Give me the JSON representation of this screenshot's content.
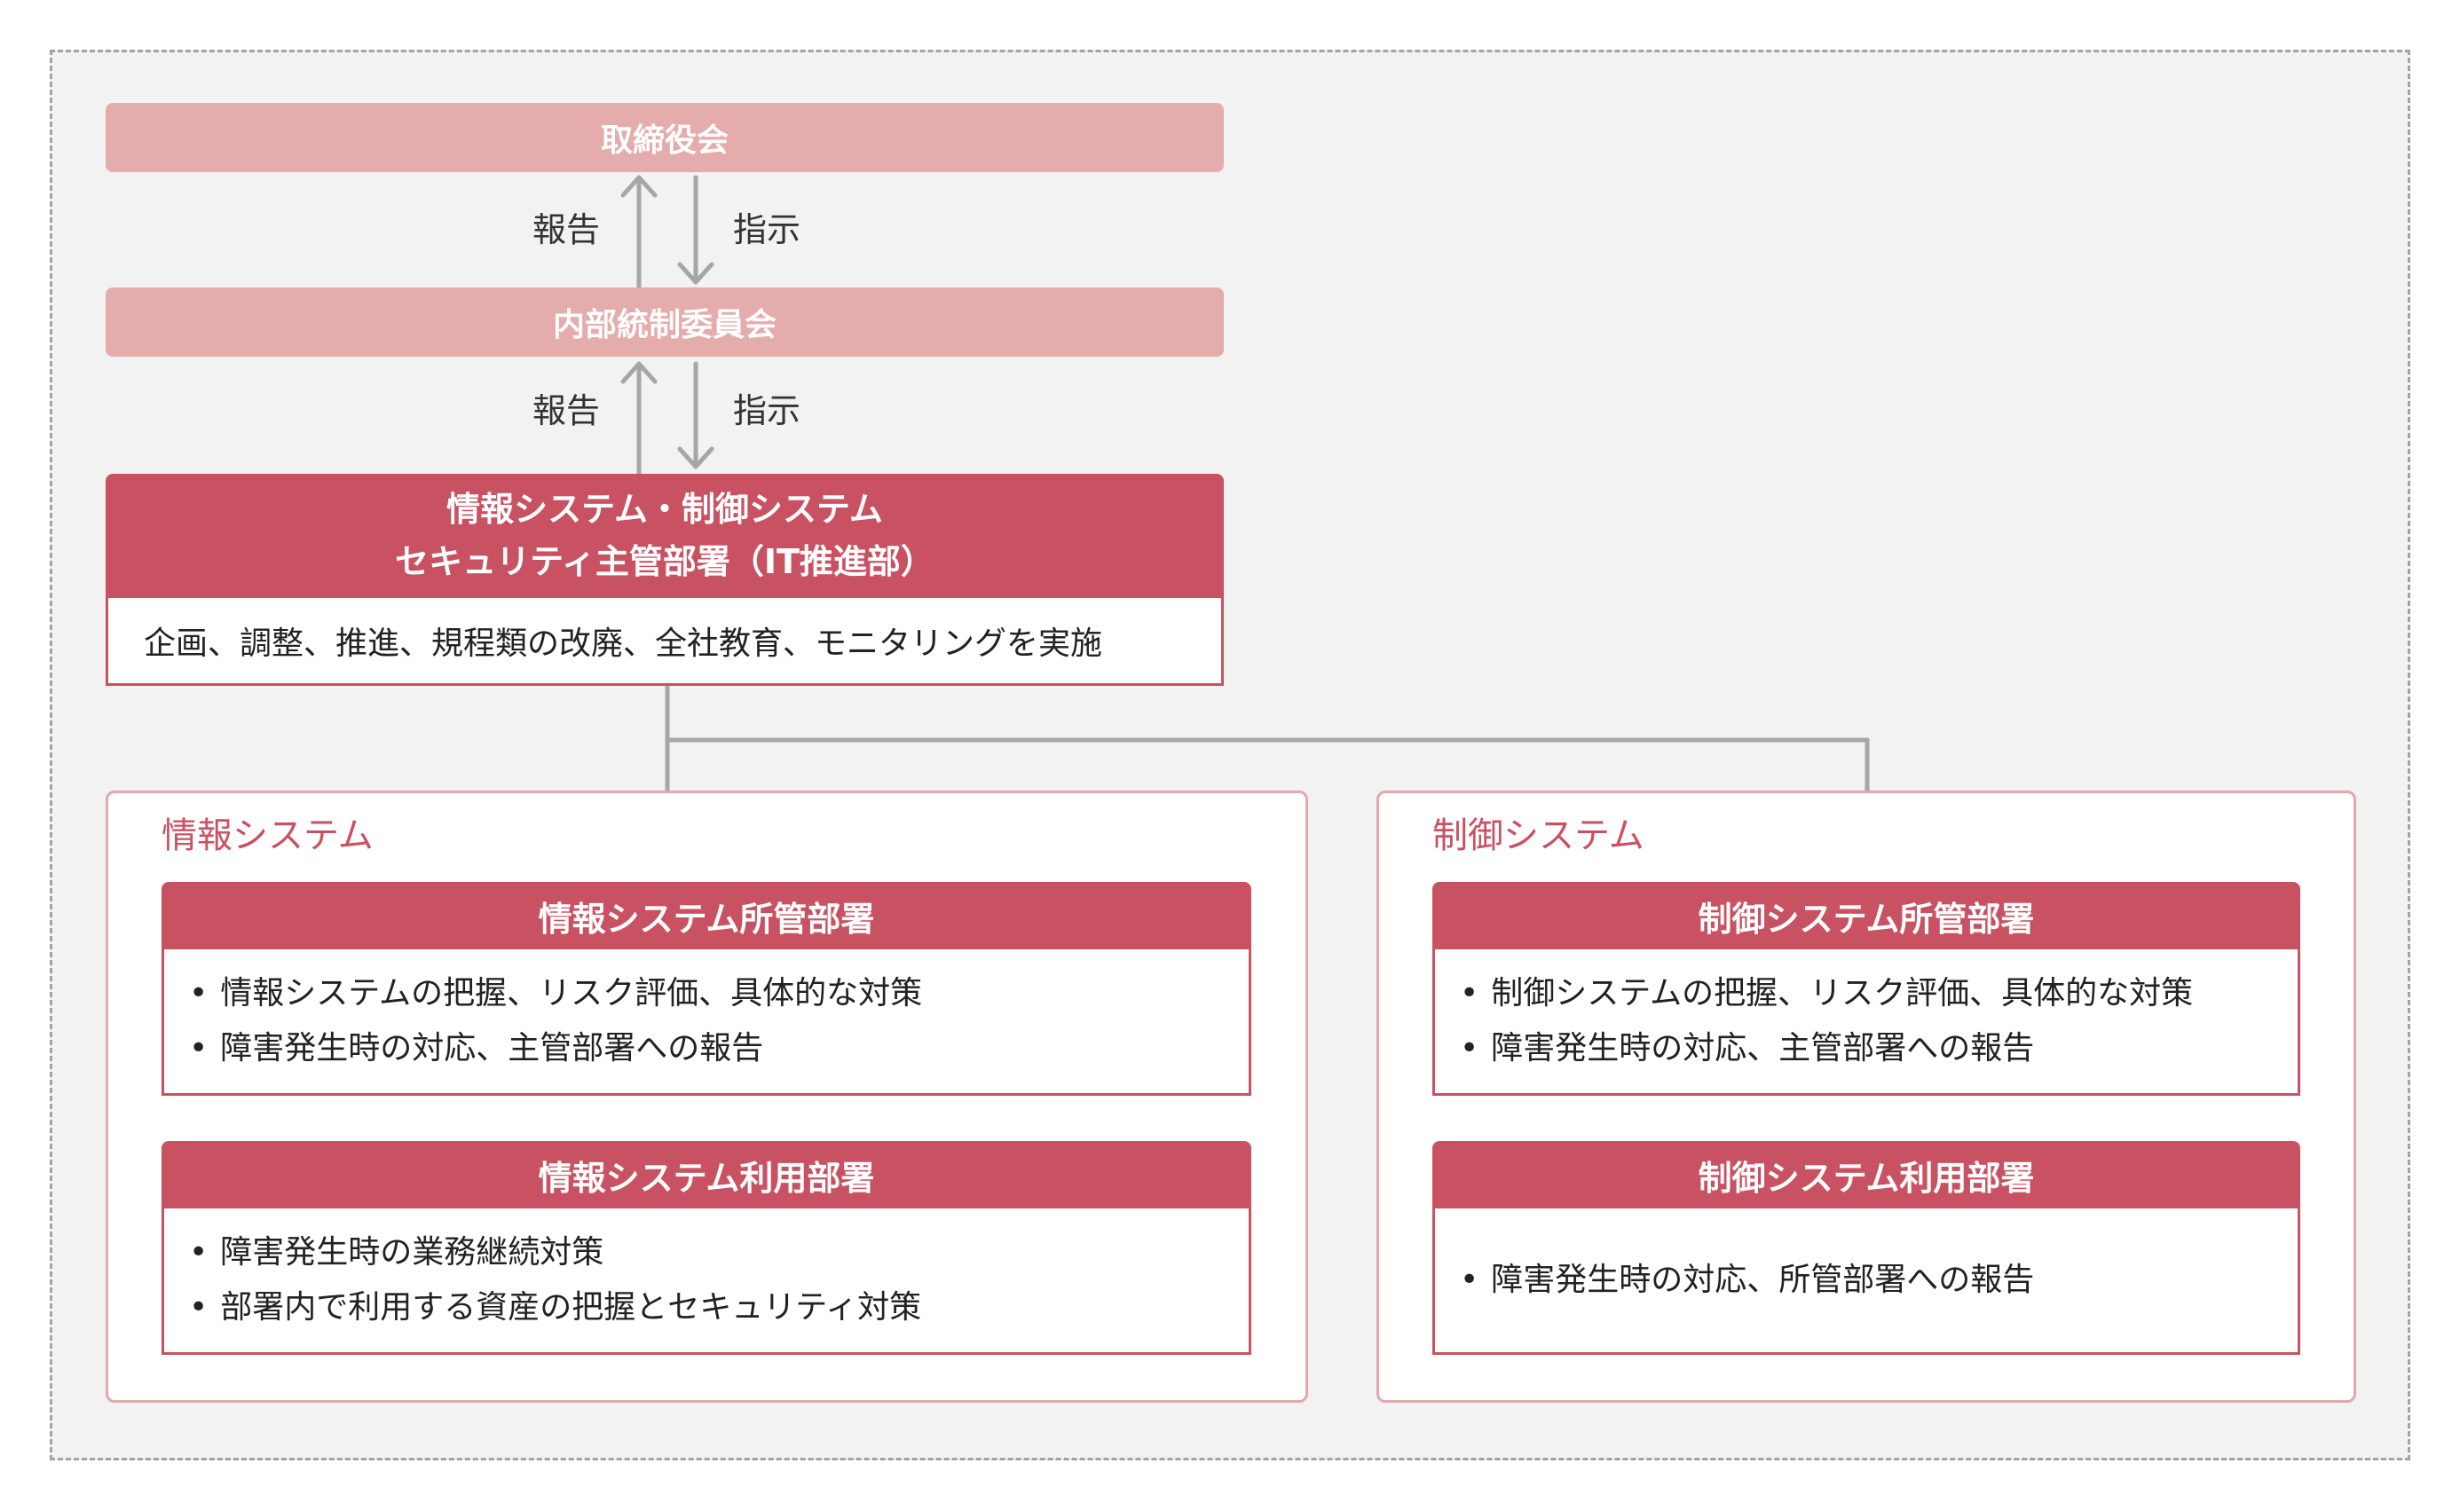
{
  "board": {
    "label": "取締役会"
  },
  "committee": {
    "label": "内部統制委員会"
  },
  "edges": {
    "board_committee": {
      "report": "報告",
      "instruct": "指示"
    },
    "committee_it": {
      "report": "報告",
      "instruct": "指示"
    }
  },
  "it_dept": {
    "title_line1": "情報システム・制御システム",
    "title_line2": "セキュリティ主管部署（IT推進部）",
    "description": "企画、調整、推進、規程類の改廃、全社教育、モニタリングを実施"
  },
  "groups": [
    {
      "title": "情報システム",
      "departments": [
        {
          "name": "情報システム所管部署",
          "items": [
            "情報システムの把握、リスク評価、具体的な対策",
            "障害発生時の対応、主管部署への報告"
          ]
        },
        {
          "name": "情報システム利用部署",
          "items": [
            "障害発生時の業務継続対策",
            "部署内で利用する資産の把握とセキュリティ対策"
          ]
        }
      ]
    },
    {
      "title": "制御システム",
      "departments": [
        {
          "name": "制御システム所管部署",
          "items": [
            "制御システムの把握、リスク評価、具体的な対策",
            "障害発生時の対応、主管部署への報告"
          ]
        },
        {
          "name": "制御システム利用部署",
          "items": [
            "障害発生時の対応、所管部署への報告"
          ]
        }
      ]
    }
  ],
  "colors": {
    "accent": "#c95262",
    "light_pink": "#e5acac",
    "group_border": "#e3a7ad",
    "connector": "#a6a6a6",
    "frame_bg": "#f2f2f2"
  }
}
